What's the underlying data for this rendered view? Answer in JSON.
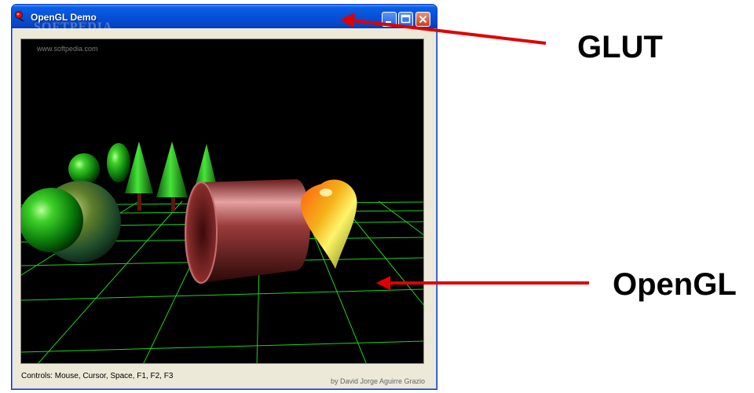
{
  "window": {
    "title": "OpenGL Demo",
    "watermark_title": "SOFTPEDIA",
    "viewport_watermark": "www.softpedia.com",
    "status_controls": "Controls: Mouse, Cursor, Space, F1, F2, F3",
    "status_author": "by David Jorge Aguirre Grazio"
  },
  "annotations": {
    "glut_label": "GLUT",
    "opengl_label": "OpenGL"
  },
  "icons": [
    "app-icon",
    "minimize-icon",
    "maximize-icon",
    "close-icon"
  ],
  "colors": {
    "title_bar": "#0650d8",
    "grid": "#1fd11f",
    "arrow": "#e00000"
  }
}
